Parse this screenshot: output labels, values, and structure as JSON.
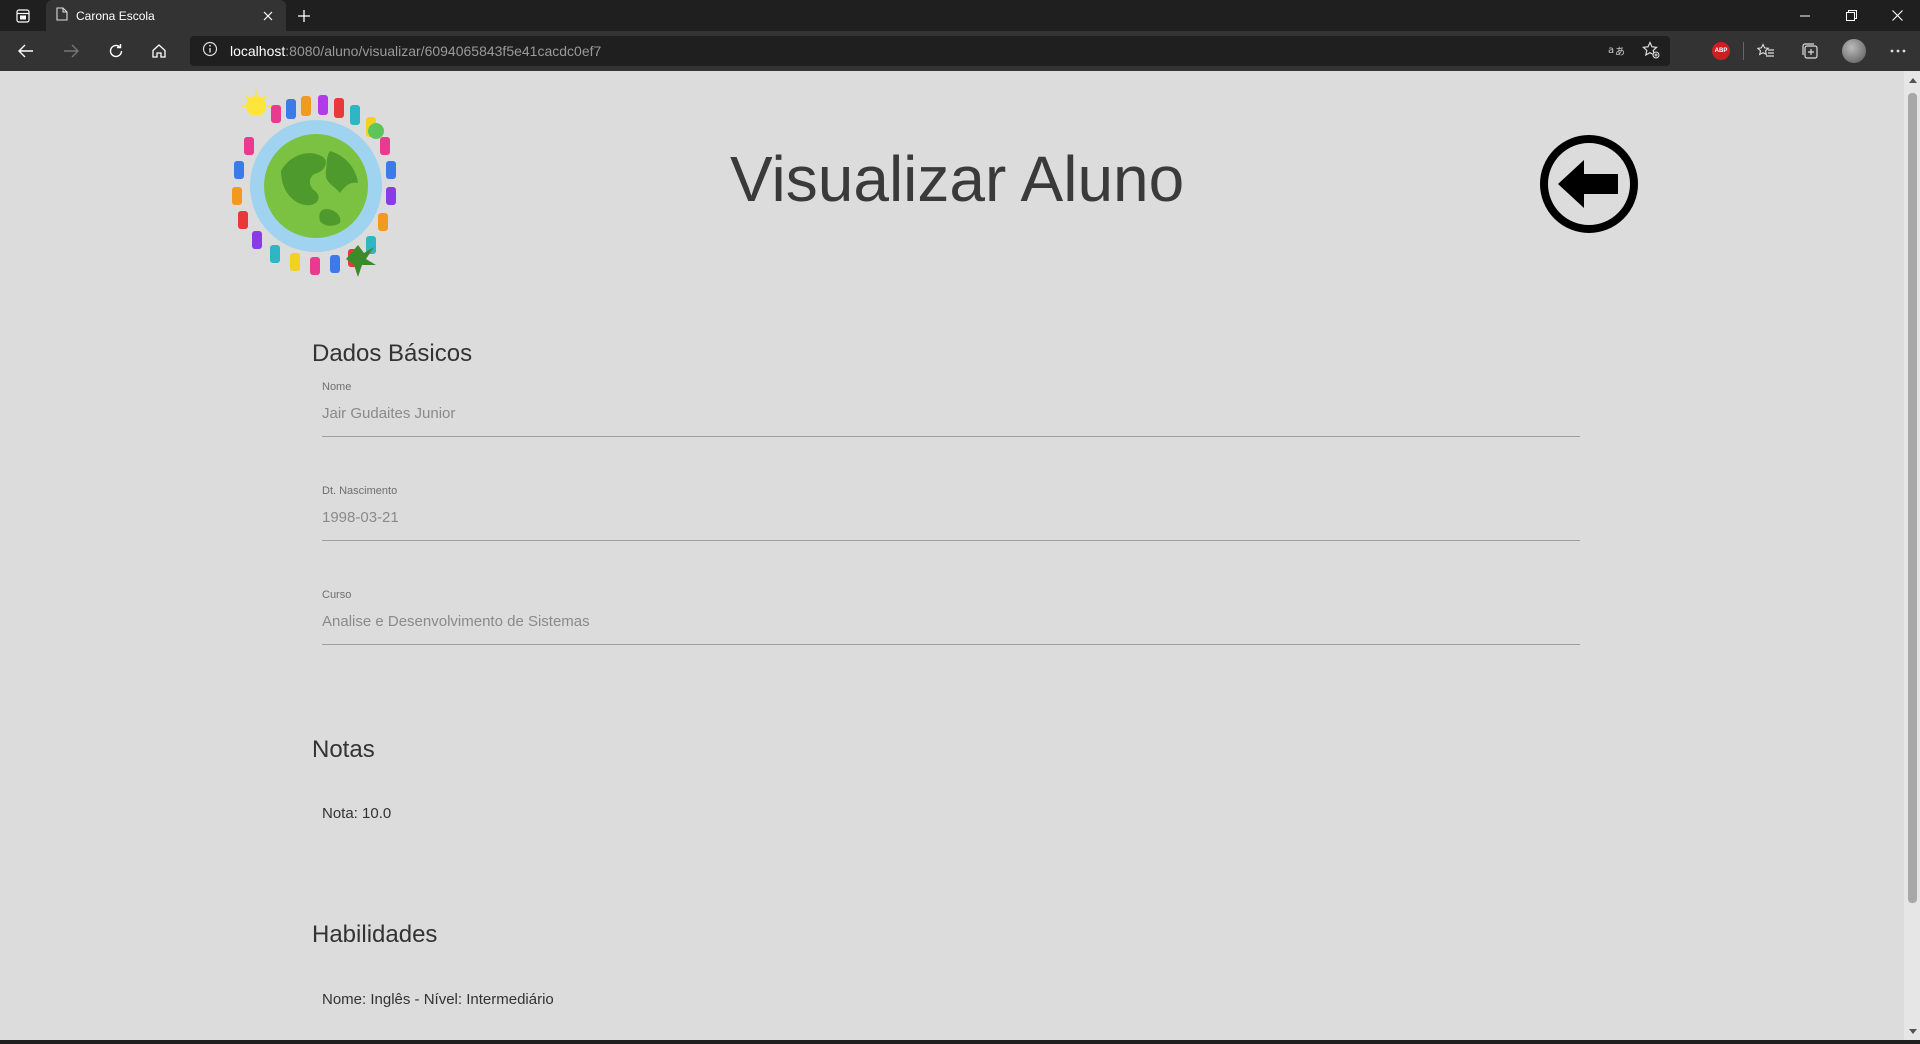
{
  "browser": {
    "tab_title": "Carona Escola",
    "url_host": "localhost",
    "url_path": ":8080/aluno/visualizar/6094065843f5e41cacdc0ef7",
    "extension_badge": "ABP"
  },
  "page": {
    "title": "Visualizar Aluno",
    "sections": {
      "basic": {
        "title": "Dados Básicos",
        "fields": [
          {
            "label": "Nome",
            "value": "Jair Gudaites Junior"
          },
          {
            "label": "Dt. Nascimento",
            "value": "1998-03-21"
          },
          {
            "label": "Curso",
            "value": "Analise e Desenvolvimento de Sistemas"
          }
        ]
      },
      "grades": {
        "title": "Notas",
        "items": [
          "Nota: 10.0"
        ]
      },
      "skills": {
        "title": "Habilidades",
        "items": [
          "Nome: Inglês - Nível: Intermediário"
        ]
      }
    }
  },
  "colors": {
    "page_bg": "#dcdcdc",
    "chrome_dark": "#1f1f1f",
    "chrome_toolbar": "#333333",
    "globe_green": "#7cc242",
    "globe_blue": "#9fd3f0"
  }
}
